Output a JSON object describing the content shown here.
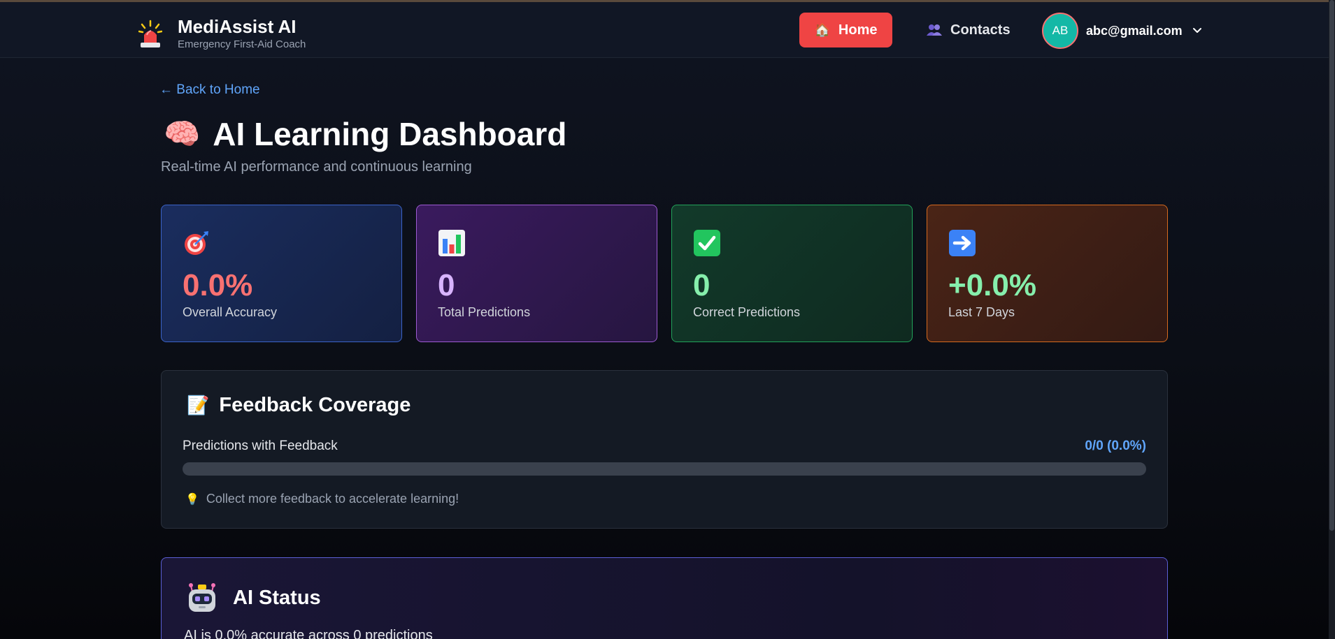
{
  "navbar": {
    "brand_name": "MediAssist AI",
    "brand_tagline": "Emergency First-Aid Coach",
    "brand_icon": "siren-icon",
    "home_label": "Home",
    "home_icon": "🏠",
    "contacts_label": "Contacts",
    "contacts_icon": "contacts-icon",
    "user_initials": "AB",
    "user_email": "abc@gmail.com"
  },
  "page": {
    "back_link": "← Back to Home",
    "title_emoji": "🧠",
    "title": "AI Learning Dashboard",
    "subtitle": "Real-time AI performance and continuous learning"
  },
  "stats": [
    {
      "icon": "target-icon",
      "value": "0.0%",
      "label": "Overall Accuracy",
      "color": "#f87171"
    },
    {
      "icon": "bar-chart-icon",
      "value": "0",
      "label": "Total Predictions",
      "color": "#d8b4fe"
    },
    {
      "icon": "check-icon",
      "value": "0",
      "label": "Correct Predictions",
      "color": "#86efac"
    },
    {
      "icon": "arrow-right-icon",
      "value": "+0.0%",
      "label": "Last 7 Days",
      "color": "#86efac"
    }
  ],
  "feedback": {
    "emoji": "📝",
    "title": "Feedback Coverage",
    "label": "Predictions with Feedback",
    "ratio": "0/0 (0.0%)",
    "progress_percent": 0,
    "hint_emoji": "💡",
    "hint": "Collect more feedback to accelerate learning!"
  },
  "ai_status": {
    "icon": "robot-icon",
    "title": "AI Status",
    "text": "AI is 0.0% accurate across 0 predictions"
  },
  "colors": {
    "accent_red": "#ef4444",
    "link_blue": "#60a5fa",
    "avatar_teal": "#14b8a6"
  }
}
